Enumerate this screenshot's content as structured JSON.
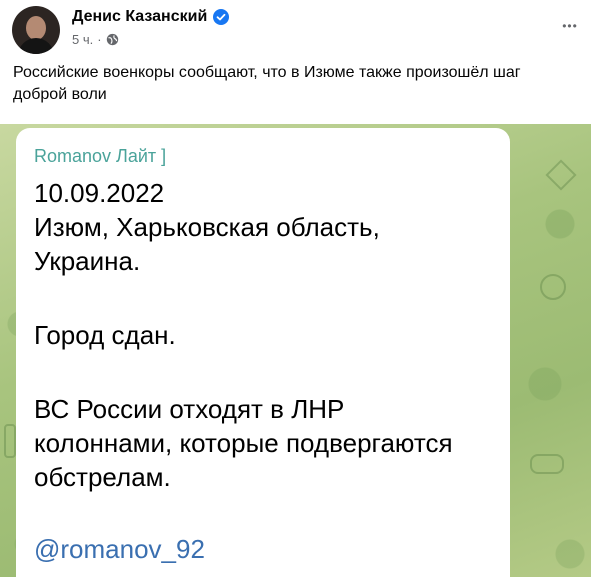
{
  "post": {
    "author": "Денис Казанский",
    "time": "5 ч.",
    "separator": "·",
    "text": "Российские военкоры сообщают, что в Изюме также произошёл шаг доброй воли",
    "more_label": "•••",
    "icons": {
      "verified": "verified-badge-icon",
      "audience": "globe-icon",
      "more": "more-options-icon"
    },
    "colors": {
      "verified": "#1877f2",
      "meta": "#65676b"
    }
  },
  "telegram": {
    "channel": "Romanov Лайт ]",
    "lines": [
      "10.09.2022",
      "Изюм, Харьковская область,",
      "Украина.",
      "Город сдан.",
      "ВС России отходят в ЛНР",
      "колоннами, которые подвергаются",
      "обстрелам."
    ],
    "handle": "@romanov_92",
    "colors": {
      "channel": "#4aa39a",
      "handle": "#3a6fb0",
      "background": "#a8c47e"
    }
  }
}
